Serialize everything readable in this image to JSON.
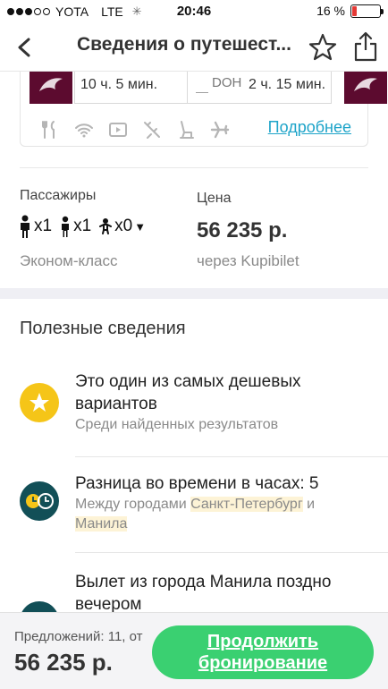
{
  "status_bar": {
    "carrier": "YOTA",
    "network": "LTE",
    "time": "20:46",
    "battery_percent": "16 %",
    "battery_level": 0.16,
    "signal_bars_filled": 3,
    "signal_bars_total": 5
  },
  "nav": {
    "title": "Сведения о путешест...",
    "back_icon": "chevron-left-icon",
    "favorite_icon": "star-outline-icon",
    "share_icon": "share-icon"
  },
  "flight": {
    "segment1_duration": "10 ч. 5 мин.",
    "layover_code": "DOH",
    "segment2_duration": "2 ч. 15 мин.",
    "amenities": [
      "cutlery-icon",
      "wifi-icon",
      "video-icon",
      "no-power-icon",
      "seat-icon",
      "plane-icon"
    ],
    "details_link": "Подробнее",
    "brand_color": "#5c0b2f"
  },
  "passengers": {
    "label": "Пассажиры",
    "adults": "x1",
    "children": "x1",
    "infants": "x0",
    "class": "Эконом-класс"
  },
  "price": {
    "label": "Цена",
    "value": "56 235 р.",
    "via": "через Kupibilet"
  },
  "useful": {
    "heading": "Полезные сведения",
    "items": [
      {
        "title": "Это один из самых дешевых вариантов",
        "sub": "Среди найденных результатов",
        "icon": "star-icon",
        "color": "#f5c518"
      },
      {
        "title": "Разница во времени в часах: 5",
        "sub_prefix": "Между городами",
        "city1": "Санкт-Петербург",
        "sub_mid": "и",
        "city2": "Манила",
        "icon": "clocks-icon",
        "color": "#124f57"
      },
      {
        "title": "Вылет из города Манила поздно вечером",
        "icon": "moon-icon",
        "color": "#124f57"
      }
    ]
  },
  "bottom": {
    "offers": "Предложений: 11, от",
    "price": "56 235 р.",
    "button_line1": "Продолжить",
    "button_line2": "бронирование",
    "button_color": "#3ad071"
  }
}
